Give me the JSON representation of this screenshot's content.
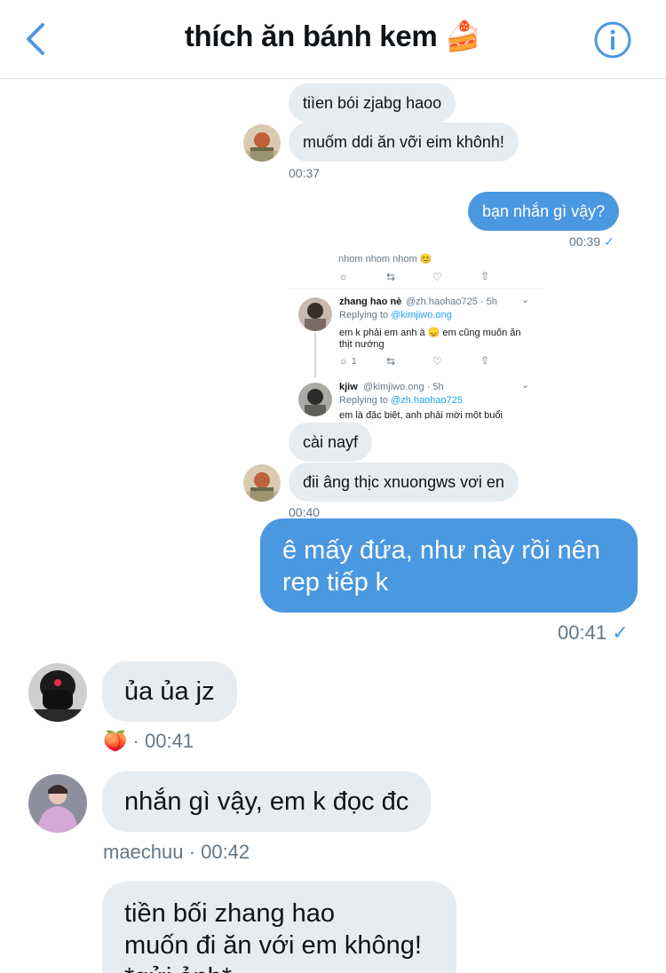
{
  "header": {
    "title": "thích ăn bánh kem",
    "title_emoji": "🍰",
    "back_icon": "chevron-left-icon",
    "info_icon": "info-circle-icon",
    "accent": "#4a98e0"
  },
  "messages": {
    "m1": "tiìen bói zjabg haoo",
    "m2": "muốm ddi ăn vỡi eim khônh!",
    "m2_time": "00:37",
    "m3": "bạn nhắn gì vậy?",
    "m3_time": "00:39",
    "m4": "cài nayf",
    "m5": "đii âng thịc xnuongws vơi en",
    "m5_time": "00:40",
    "m6": "ê mấy đứa, như này rồi nên rep tiếp k",
    "m6_time": "00:41",
    "m7": "ủa ủa jz",
    "m7_emoji": "🍑",
    "m7_sep": "·",
    "m7_time": "00:41",
    "m8": "nhắn gì vậy, em k đọc đc",
    "m8_sender": "maechuu",
    "m8_sep": "·",
    "m8_time": "00:42",
    "m9": "tiền bối zhang hao\nmuốn đi ăn với em không!\n*gửi ảnh*"
  },
  "check_mark": "✓",
  "shot": {
    "top_text": "nhom nhom nhom 😊",
    "tweet1_name": "zhang hao nè",
    "tweet1_handle": "@zh.haohao725 · 5h",
    "tweet1_reply_prefix": "Replying to",
    "tweet1_reply_to": "@kimjiwo.ong",
    "tweet1_text_1": "em k phải em anh à 😞 em cũng muốn ăn",
    "tweet1_text_2": "thịt nướng",
    "tweet1_reply_count": "1",
    "tweet2_name": "kjiw",
    "tweet2_handle": "@kimjiwo.ong · 5h",
    "tweet2_reply_prefix": "Replying to",
    "tweet2_reply_to": "@zh.haohao725",
    "tweet2_text_1": "em là đặc biệt, anh phải mời một buổi"
  }
}
